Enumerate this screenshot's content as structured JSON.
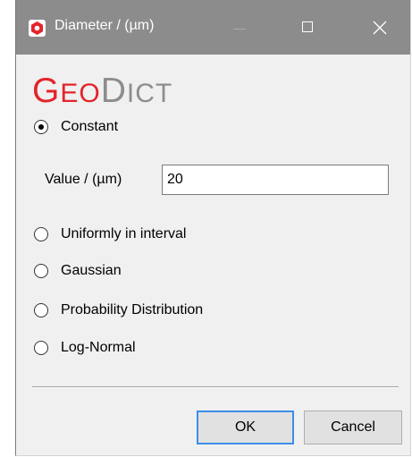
{
  "window": {
    "title": "Diameter / (µm)",
    "icon": "geodict-app-icon",
    "controls": [
      "minimize-icon",
      "maximize-icon",
      "close-icon"
    ]
  },
  "logo": {
    "text": "GeoDict",
    "color": "#e3242b"
  },
  "options": [
    {
      "label": "Constant",
      "selected": true
    },
    {
      "label": "Uniformly in interval",
      "selected": false
    },
    {
      "label": "Gaussian",
      "selected": false
    },
    {
      "label": "Probability Distribution",
      "selected": false
    },
    {
      "label": "Log-Normal",
      "selected": false
    }
  ],
  "value_field": {
    "label": "Value / (µm)",
    "value": "20"
  },
  "buttons": {
    "ok": "OK",
    "cancel": "Cancel"
  },
  "colors": {
    "titlebar": "#8c8c8c",
    "dialog_bg": "#f0f0f0",
    "default_button_border": "#3c8ee8"
  }
}
